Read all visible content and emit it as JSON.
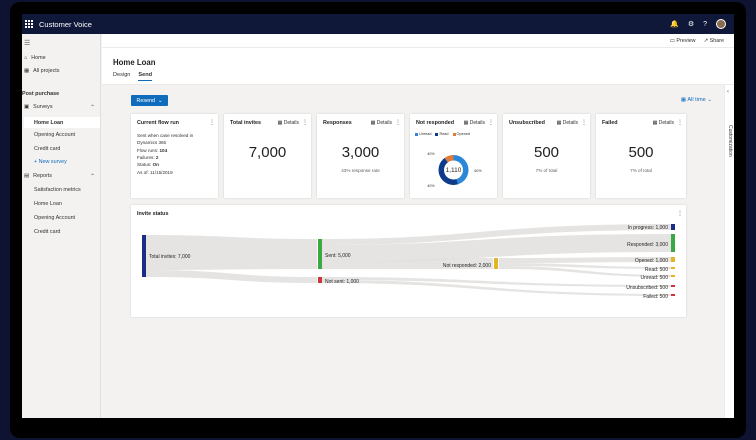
{
  "app": {
    "title": "Customer Voice"
  },
  "topbar": {
    "icons": [
      "waffle-icon",
      "bell-icon",
      "gear-icon",
      "help-icon",
      "avatar"
    ]
  },
  "sidebar": {
    "home": "Home",
    "all_projects": "All projects",
    "project_name": "Post purchase",
    "surveys_label": "Surveys",
    "surveys": [
      "Home Loan",
      "Opening Account",
      "Credit card"
    ],
    "new_survey": "+ New survey",
    "reports_label": "Reports",
    "reports": [
      "Satisfaction metrics",
      "Home Loan",
      "Opening Account",
      "Credit card"
    ]
  },
  "commands": {
    "preview": "Preview",
    "share": "Share"
  },
  "page": {
    "title": "Home Loan",
    "tabs": [
      "Design",
      "Send"
    ],
    "active_tab": "Send"
  },
  "toolbar": {
    "resend": "Resend",
    "time_filter": "All time"
  },
  "right_rail": {
    "label": "Customization"
  },
  "cards": {
    "flow": {
      "title": "Current flow run",
      "line1": "Sent when case resolved in",
      "line2": "Dynamics 365",
      "flow_runs_label": "Flow runs:",
      "flow_runs": "104",
      "failures_label": "Failures:",
      "failures": "2",
      "status_label": "Status:",
      "status": "On",
      "asof": "As of: 11/15/2019"
    },
    "details_label": "Details",
    "total": {
      "title": "Total invites",
      "value": "7,000"
    },
    "responses": {
      "title": "Responses",
      "value": "3,000",
      "sub": "43% response rate"
    },
    "not_responded": {
      "title": "Not responded",
      "center": "1,110",
      "legend": [
        "Unread",
        "Read",
        "Opened"
      ],
      "labels": [
        "40%",
        "40%",
        "60%"
      ],
      "segments": [
        {
          "name": "Unread",
          "fraction": 0.45,
          "color": "#2b88d8"
        },
        {
          "name": "Read",
          "fraction": 0.45,
          "color": "#0f3c8a"
        },
        {
          "name": "Opened",
          "fraction": 0.1,
          "color": "#e07b3a"
        }
      ]
    },
    "unsubscribed": {
      "title": "Unsubscribed",
      "value": "500",
      "sub": "7% of total"
    },
    "failed": {
      "title": "Failed",
      "value": "500",
      "sub": "7% of total"
    }
  },
  "invite_status": {
    "title": "Invite status",
    "nodes": {
      "total": "Total invites: 7,000",
      "sent": "Sent: 5,000",
      "not_sent": "Not sent: 1,000",
      "not_responded": "Not responded: 2,000",
      "in_progress": "In progress: 1,000",
      "responded": "Responded: 3,000",
      "opened": "Opened: 1,000",
      "read": "Read: 500",
      "unread": "Unread: 500",
      "unsubscribed": "Unsubscribed: 500",
      "failed": "Failed: 500"
    },
    "colors": {
      "total": "#1a2e86",
      "sent": "#3aa845",
      "not_sent": "#d13438",
      "not_responded": "#e3b524",
      "in_progress": "#1a2e86",
      "responded": "#3aa845",
      "opened": "#e3b524",
      "read": "#e3b524",
      "unread": "#e3b524",
      "unsubscribed": "#d13438",
      "failed": "#d13438"
    }
  },
  "colors": {
    "accent": "#0f6cbd",
    "topbar": "#10183a"
  }
}
